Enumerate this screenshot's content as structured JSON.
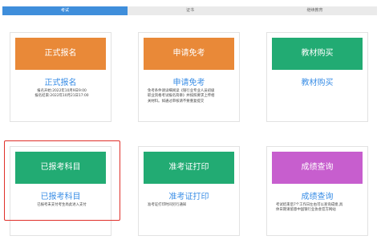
{
  "tabs": [
    {
      "label": "考试"
    },
    {
      "label": "证书"
    },
    {
      "label": "继续教育"
    }
  ],
  "cards": [
    {
      "title": "正式报名",
      "subtitle": "正式报名",
      "lines": [
        "报名开始:2022年10月9日9:00",
        "报名结束:2022年10月21日17:00"
      ],
      "color": "#e98938"
    },
    {
      "title": "申请免考",
      "subtitle": "申请免考",
      "lines": [
        "免考条件请详细阅读《银行业专业人员初级",
        "职业资格考试报名简章》并按照要求上传相",
        "关材料。如通过审核请不要重复提交"
      ],
      "color": "#e98938"
    },
    {
      "title": "教材购买",
      "subtitle": "教材购买",
      "lines": [],
      "color": "#22ab73"
    },
    {
      "title": "已报考科目",
      "subtitle": "已报考科目",
      "lines": [
        "已报考未支付考生尚此进入支付"
      ],
      "color": "#22ab73"
    },
    {
      "title": "准考证打印",
      "subtitle": "准考证打印",
      "lines": [
        "准考证打印时间另行通知"
      ],
      "color": "#22ab73"
    },
    {
      "title": "成绩查询",
      "subtitle": "成绩查询",
      "lines": [
        "考试结束后7个工作日左右可以查询成绩,具",
        "体日期请留意中国银行业协会官方网站"
      ],
      "color": "#c75ece"
    }
  ],
  "highlight_color": "#e0302a"
}
